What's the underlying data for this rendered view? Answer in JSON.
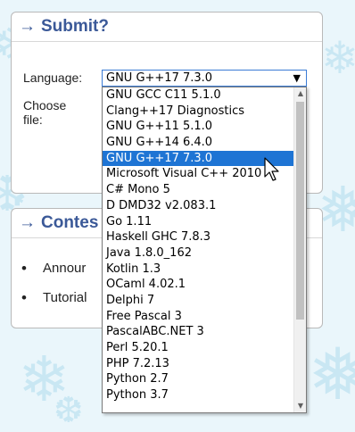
{
  "submit_panel": {
    "arrow": "→",
    "title": "Submit?",
    "language_label": "Language:",
    "choose_label_line1": "Choose",
    "choose_label_line2": "file:"
  },
  "language_select": {
    "selected": "GNU G++17 7.3.0",
    "caret": "▼",
    "options": [
      "GNU GCC C11 5.1.0",
      "Clang++17 Diagnostics",
      "GNU G++11 5.1.0",
      "GNU G++14 6.4.0",
      "GNU G++17 7.3.0",
      "Microsoft Visual C++ 2010",
      "C# Mono 5",
      "D DMD32 v2.083.1",
      "Go 1.11",
      "Haskell GHC 7.8.3",
      "Java 1.8.0_162",
      "Kotlin 1.3",
      "OCaml 4.02.1",
      "Delphi 7",
      "Free Pascal 3",
      "PascalABC.NET 3",
      "Perl 5.20.1",
      "PHP 7.2.13",
      "Python 2.7",
      "Python 3.7"
    ],
    "highlighted_index": 4
  },
  "contest_panel": {
    "arrow": "→",
    "title": "Contes",
    "items": [
      "Annour",
      "Tutorial"
    ]
  },
  "colors": {
    "accent": "#3b5998",
    "selection": "#1e74d4",
    "background": "#eaf6fb"
  }
}
